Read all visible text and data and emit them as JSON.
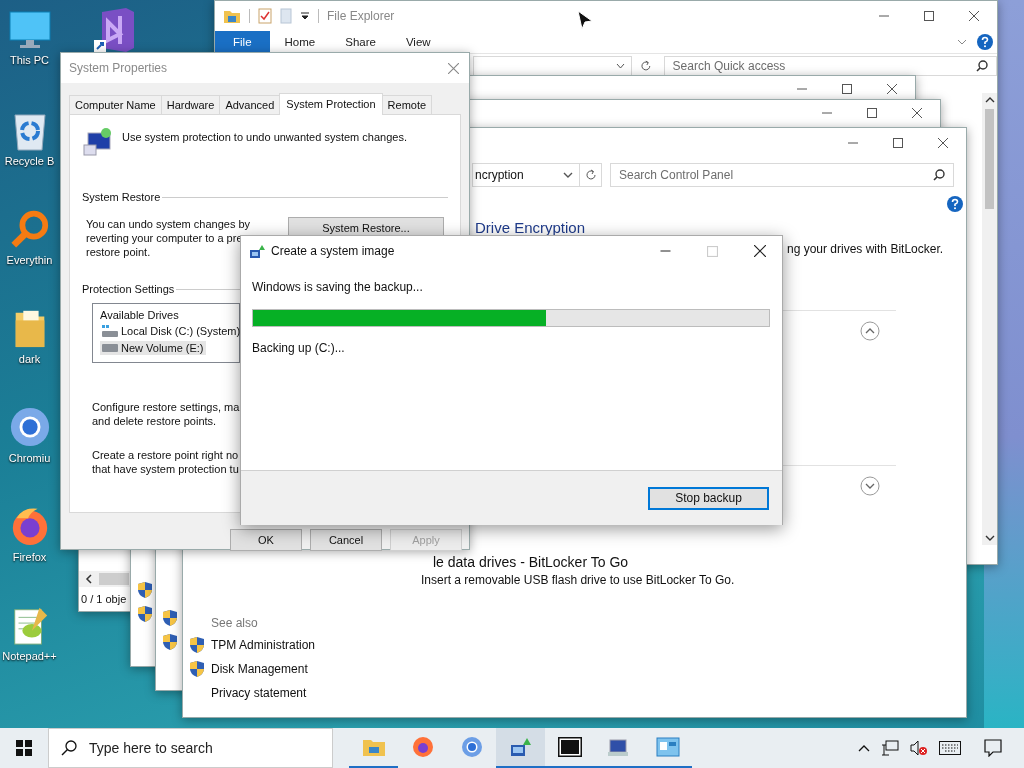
{
  "desktop_icons": [
    {
      "label": "This PC",
      "kind": "monitor"
    },
    {
      "label": "Recycle B",
      "kind": "bin"
    },
    {
      "label": "Everythin",
      "kind": "search"
    },
    {
      "label": "dark",
      "kind": "folder"
    },
    {
      "label": "Chromiu",
      "kind": "chromium"
    },
    {
      "label": "Firefox",
      "kind": "firefox"
    },
    {
      "label": "Notepad++",
      "kind": "notepad"
    }
  ],
  "back_window": {
    "status": "0 / 1 obje"
  },
  "file_explorer": {
    "title": "File Explorer",
    "ribbon_tabs": [
      {
        "label": "File",
        "selected": true
      },
      {
        "label": "Home",
        "selected": false
      },
      {
        "label": "Share",
        "selected": false
      },
      {
        "label": "View",
        "selected": false
      }
    ],
    "search": {
      "placeholder": "Search Quick access"
    }
  },
  "stacked_windows": [
    {
      "kind": "window"
    },
    {
      "kind": "window"
    }
  ],
  "control_panel": {
    "address": "ncryption",
    "search": {
      "placeholder": "Search Control Panel"
    },
    "heading": "Drive Encryption",
    "intro": "ng your drives with BitLocker.",
    "sections": [
      {
        "expanded": true
      },
      {
        "expanded": false
      }
    ],
    "removable_heading": "le data drives - BitLocker To Go",
    "removable_text": "Insert a removable USB flash drive to use BitLocker To Go.",
    "see_also": {
      "title": "See also",
      "links": [
        {
          "label": "TPM Administration",
          "shield": true
        },
        {
          "label": "Disk Management",
          "shield": true
        },
        {
          "label": "Privacy statement",
          "shield": false
        }
      ]
    }
  },
  "system_properties": {
    "title": "System Properties",
    "tabs": [
      {
        "label": "Computer Name",
        "selected": false
      },
      {
        "label": "Hardware",
        "selected": false
      },
      {
        "label": "Advanced",
        "selected": false
      },
      {
        "label": "System Protection",
        "selected": true
      },
      {
        "label": "Remote",
        "selected": false
      }
    ],
    "intro": "Use system protection to undo unwanted system changes.",
    "restore_group": "System Restore",
    "restore_lines": [
      "You can undo system changes by",
      "reverting your computer to a pre",
      "restore point."
    ],
    "restore_button": "System Restore...",
    "protection_group": "Protection Settings",
    "drives_header": "Available Drives",
    "drives": [
      {
        "label": "Local Disk (C:) (System)",
        "kind": "system",
        "selected": false
      },
      {
        "label": "New Volume (E:)",
        "kind": "drive",
        "selected": true
      }
    ],
    "configure_lines": [
      "Configure restore settings, ma",
      "and delete restore points."
    ],
    "create_lines": [
      "Create a restore point right no",
      "that have system protection tu"
    ],
    "buttons": [
      {
        "label": "OK",
        "disabled": false
      },
      {
        "label": "Cancel",
        "disabled": false
      },
      {
        "label": "Apply",
        "disabled": true
      }
    ]
  },
  "dialog": {
    "title": "Create a system image",
    "maximize_enabled": false,
    "status": "Windows is saving the backup...",
    "level": 0.567,
    "detail": "Backing up (C:)...",
    "button": "Stop backup"
  },
  "taskbar": {
    "search": {
      "placeholder": "Type here to search"
    },
    "apps": [
      {
        "kind": "explorer",
        "running": true,
        "active": false
      },
      {
        "kind": "firefox",
        "running": false,
        "active": false
      },
      {
        "kind": "chromium",
        "running": false,
        "active": false
      },
      {
        "kind": "backup",
        "running": true,
        "active": true
      },
      {
        "kind": "sevenzip",
        "running": true,
        "active": false
      },
      {
        "kind": "network",
        "running": true,
        "active": false
      },
      {
        "kind": "panel",
        "running": true,
        "active": false
      }
    ]
  }
}
